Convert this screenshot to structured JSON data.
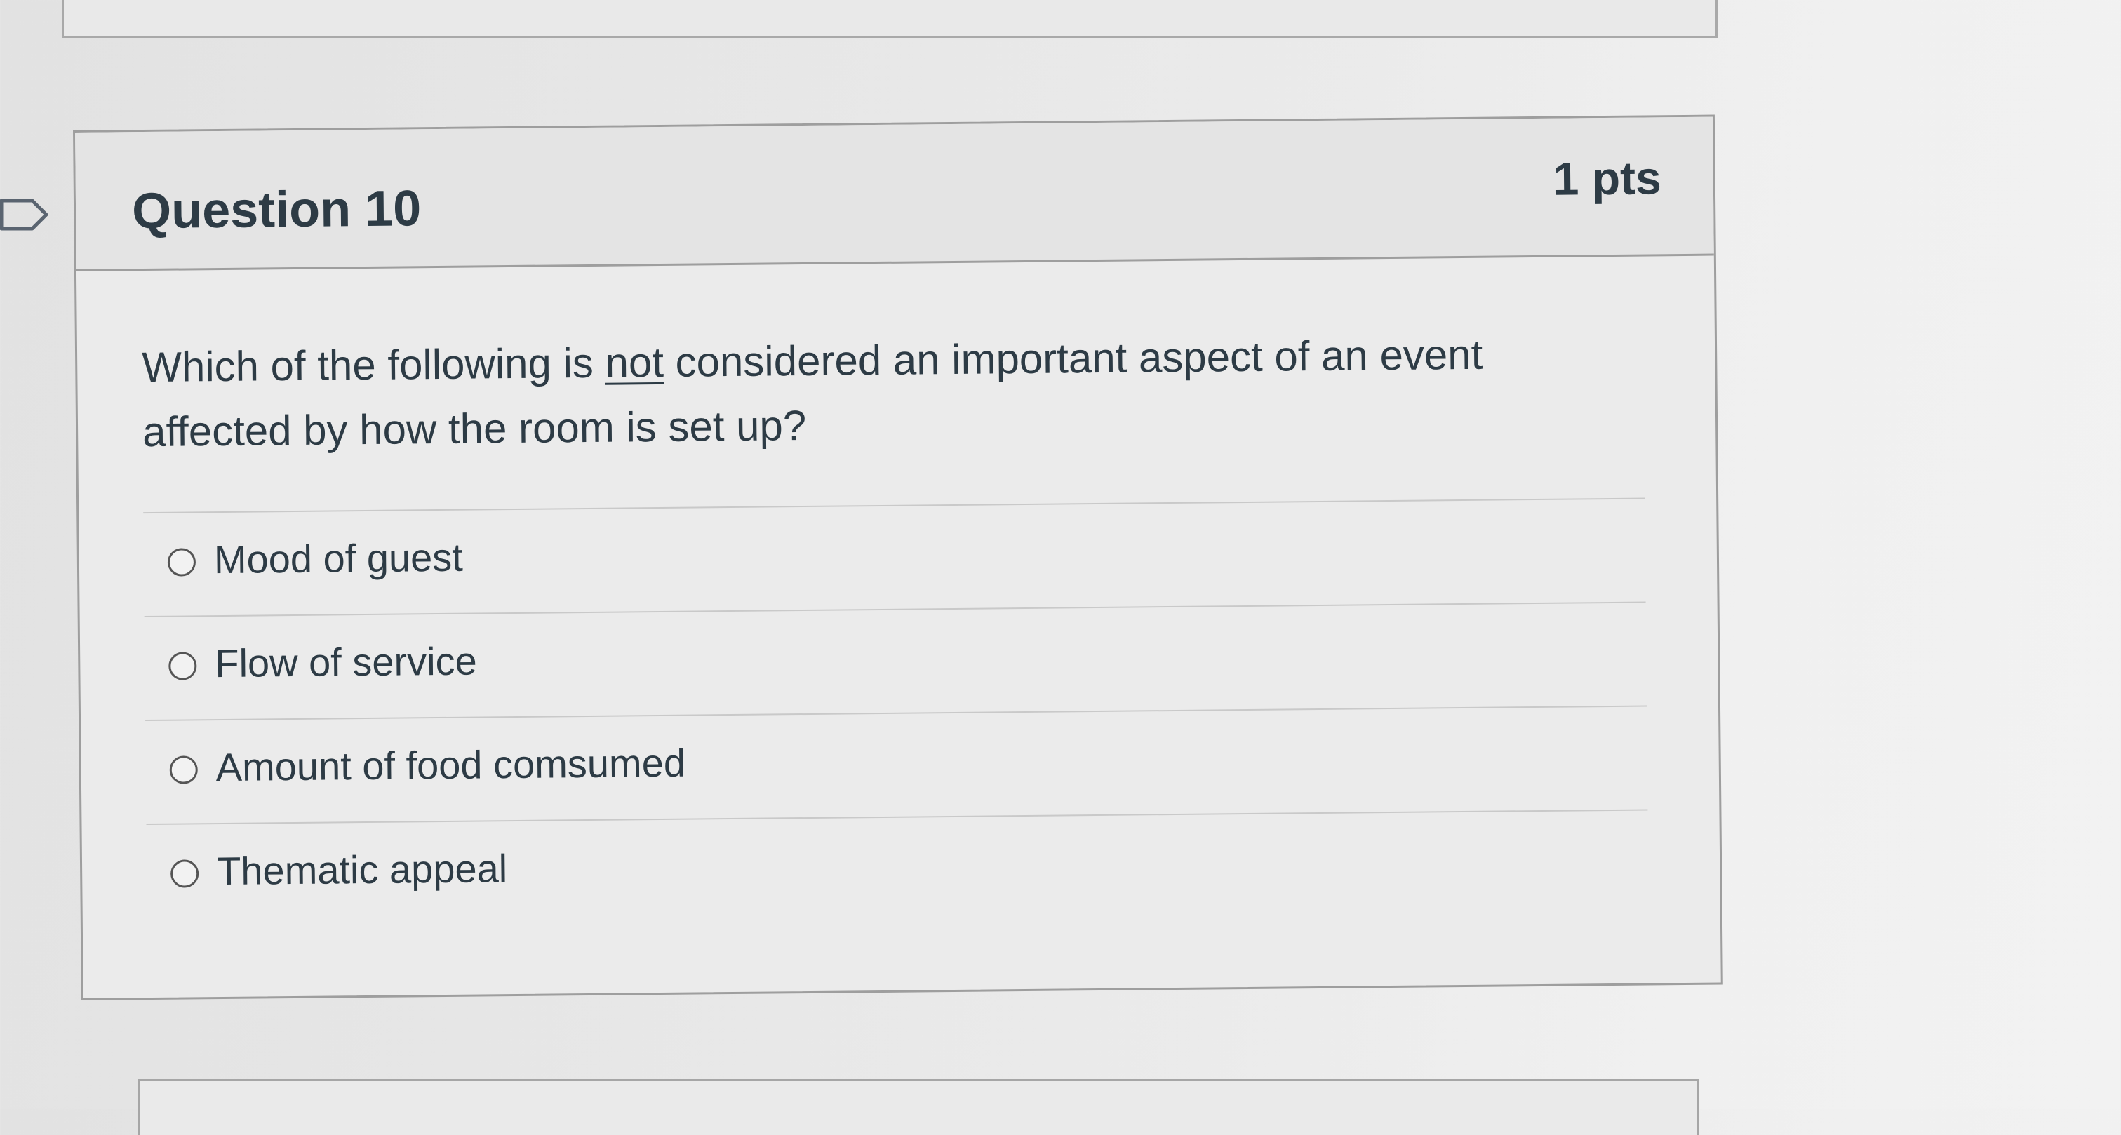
{
  "question": {
    "title": "Question 10",
    "points": "1 pts",
    "text_before": "Which of the following is ",
    "text_emphasis": "not",
    "text_after": " considered an important aspect of an event affected by how the room is set up?"
  },
  "answers": [
    {
      "label": "Mood of guest"
    },
    {
      "label": "Flow of service"
    },
    {
      "label": "Amount of food comsumed"
    },
    {
      "label": "Thematic appeal"
    }
  ]
}
